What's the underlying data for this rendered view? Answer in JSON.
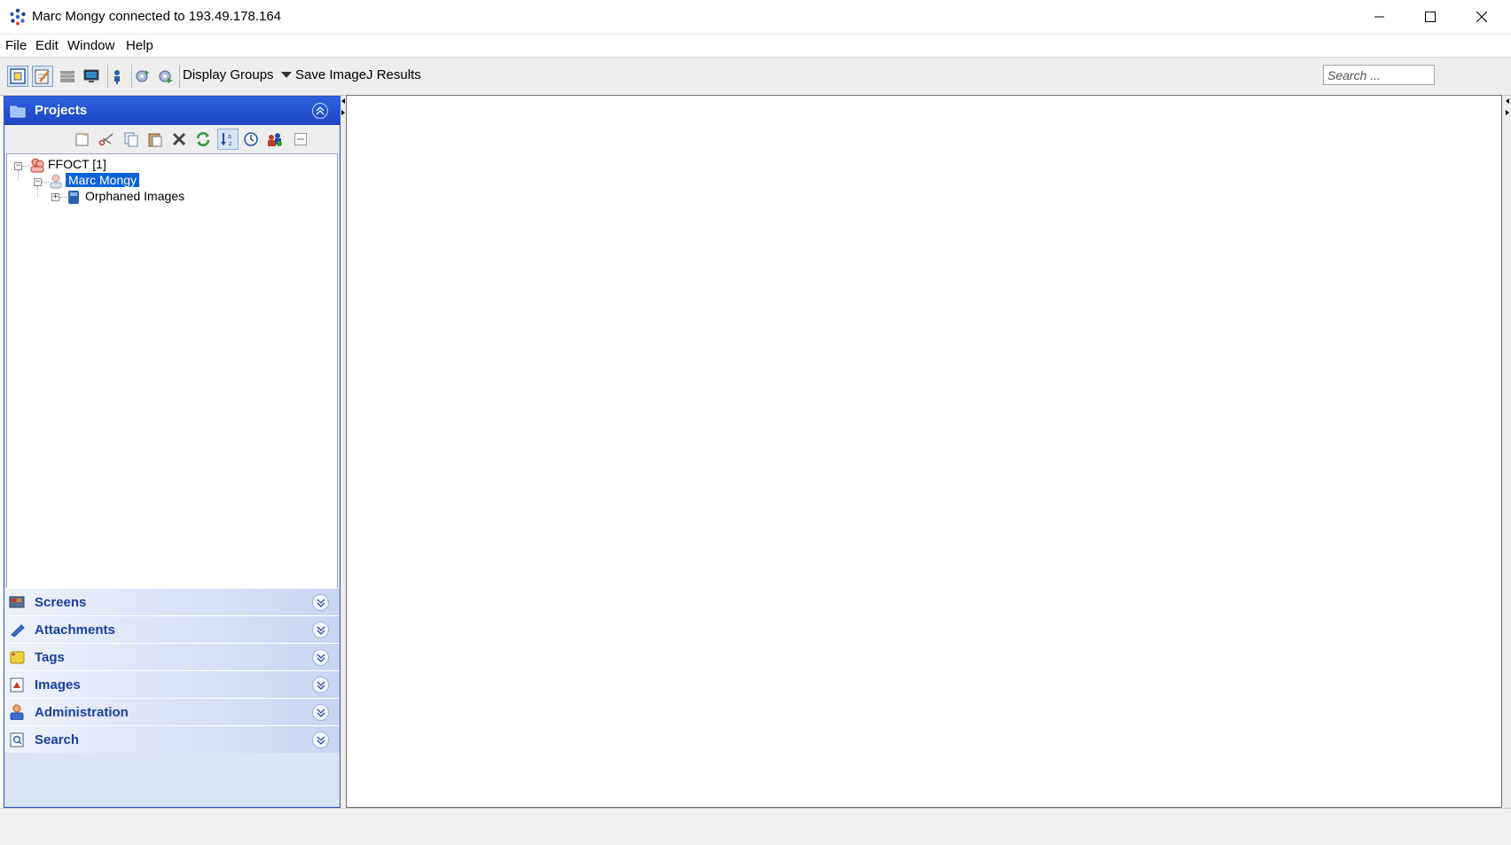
{
  "window": {
    "title": "Marc Mongy connected to 193.49.178.164",
    "controls": [
      "minimize",
      "maximize",
      "close"
    ]
  },
  "menu": {
    "items": [
      {
        "label": "File"
      },
      {
        "label": "Edit"
      },
      {
        "label": "Window"
      },
      {
        "label": "Help"
      }
    ]
  },
  "toolbar": {
    "display_groups_label": "Display Groups",
    "save_imagej_label": "Save ImageJ Results",
    "search_placeholder": "Search ..."
  },
  "sidebar": {
    "projects_title": "Projects",
    "tree": {
      "root": "FFOCT [1]",
      "user": "Marc Mongy",
      "child": "Orphaned Images"
    },
    "sections": [
      {
        "label": "Screens",
        "icon": "screens-icon"
      },
      {
        "label": "Attachments",
        "icon": "attachments-icon"
      },
      {
        "label": "Tags",
        "icon": "tags-icon"
      },
      {
        "label": "Images",
        "icon": "images-icon"
      },
      {
        "label": "Administration",
        "icon": "administration-icon"
      },
      {
        "label": "Search",
        "icon": "search-icon"
      }
    ]
  },
  "colors": {
    "header_blue": "#1c45c2",
    "selection_blue": "#0a62d8",
    "section_text": "#1a3f9e"
  }
}
